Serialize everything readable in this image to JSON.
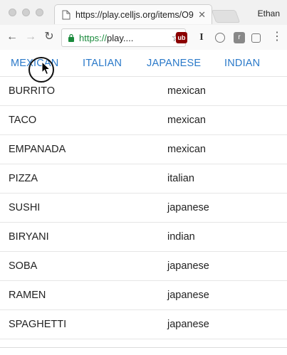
{
  "browser": {
    "tab_title": "https://play.celljs.org/items/O9",
    "tab_close": "✕",
    "profile": "Ethan",
    "url_secure": "https://",
    "url_host": "play.",
    "url_ellipsis": "...",
    "ext_ub": "ub",
    "ext_i": "I",
    "ext_r": "r"
  },
  "nav": {
    "links": [
      "MEXICAN",
      "ITALIAN",
      "JAPANESE",
      "INDIAN"
    ]
  },
  "items": [
    {
      "name": "BURRITO",
      "type": "mexican"
    },
    {
      "name": "TACO",
      "type": "mexican"
    },
    {
      "name": "EMPANADA",
      "type": "mexican"
    },
    {
      "name": "PIZZA",
      "type": "italian"
    },
    {
      "name": "SUSHI",
      "type": "japanese"
    },
    {
      "name": "BIRYANI",
      "type": "indian"
    },
    {
      "name": "SOBA",
      "type": "japanese"
    },
    {
      "name": "RAMEN",
      "type": "japanese"
    },
    {
      "name": "SPAGHETTI",
      "type": "japanese"
    }
  ],
  "colors": {
    "link": "#2a79c9",
    "secure": "#1a8a3c"
  }
}
